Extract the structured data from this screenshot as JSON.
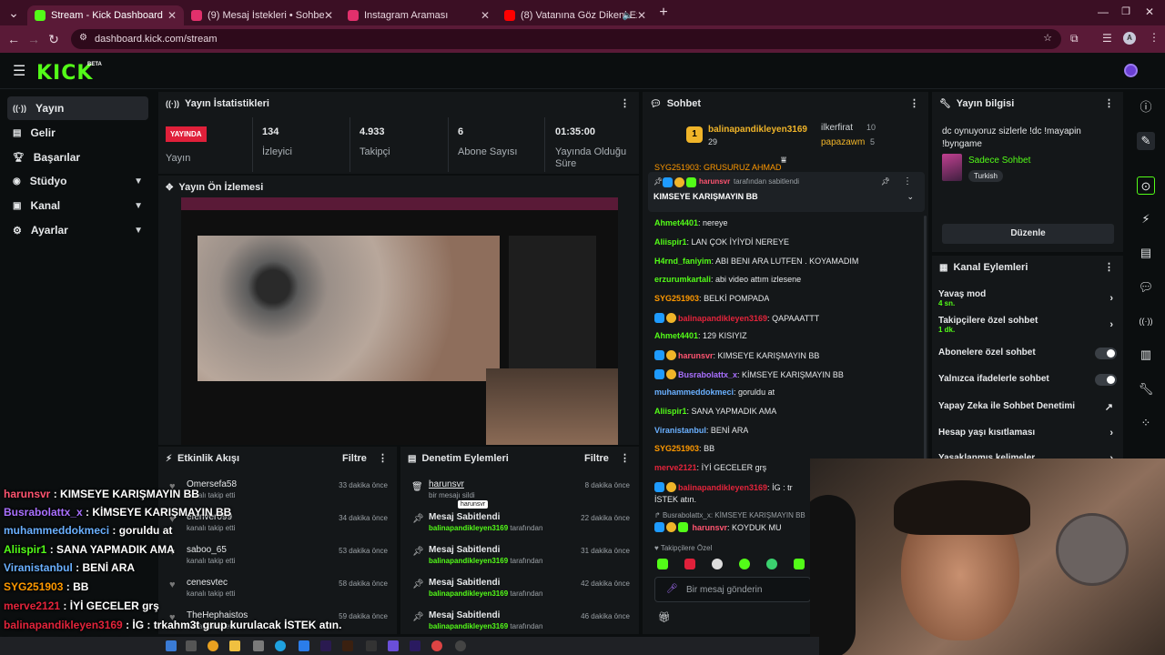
{
  "browser": {
    "tabs": [
      {
        "label": "Stream - Kick Dashboard",
        "color": "#53fc18",
        "active": true
      },
      {
        "label": "(9) Mesaj İstekleri • Sohbetler",
        "color": "#e1306c",
        "active": false
      },
      {
        "label": "Instagram Araması",
        "color": "#e1306c",
        "active": false
      },
      {
        "label": "(8) Vatanına Göz Dikeni Ez",
        "color": "#ff0000",
        "active": false
      }
    ],
    "url": "dashboard.kick.com/stream"
  },
  "header": {
    "logo": "KICK",
    "beta": "BETA"
  },
  "sidebar": {
    "items": [
      {
        "label": "Yayın",
        "icon": "radio-icon",
        "active": true
      },
      {
        "label": "Gelir",
        "icon": "wallet-icon"
      },
      {
        "label": "Başarılar",
        "icon": "trophy-icon"
      },
      {
        "label": "Stüdyo",
        "icon": "studio-icon",
        "expandable": true
      },
      {
        "label": "Kanal",
        "icon": "channel-icon",
        "expandable": true
      },
      {
        "label": "Ayarlar",
        "icon": "gear-icon",
        "expandable": true
      }
    ]
  },
  "stats": {
    "title": "Yayın İstatistikleri",
    "live_badge": "YAYINDA",
    "live_label": "Yayın",
    "viewers": "134",
    "viewers_label": "İzleyici",
    "followers": "4.933",
    "followers_label": "Takipçi",
    "subs": "6",
    "subs_label": "Abone Sayısı",
    "duration": "01:35:00",
    "duration_label": "Yayında Olduğu Süre"
  },
  "preview": {
    "title": "Yayın Ön İzlemesi"
  },
  "activity": {
    "title": "Etkinlik Akışı",
    "filter": "Filtre",
    "rows": [
      {
        "name": "Omersefa58",
        "sub": "kanalı takip etti",
        "time": "33 dakika önce"
      },
      {
        "name": "eferiver099",
        "sub": "kanalı takip etti",
        "time": "34 dakika önce"
      },
      {
        "name": "saboo_65",
        "sub": "kanalı takip etti",
        "time": "53 dakika önce"
      },
      {
        "name": "cenesvtec",
        "sub": "kanalı takip etti",
        "time": "58 dakika önce"
      },
      {
        "name": "TheHephaistos",
        "sub": "kanalı takip etti",
        "time": "59 dakika önce"
      }
    ]
  },
  "moderation": {
    "title": "Denetim Eylemleri",
    "filter": "Filtre",
    "rows": [
      {
        "title": "harunsvr",
        "sub_pre": "bir mesajı sildi",
        "sub_user": "",
        "sub_post": "",
        "time": "8 dakika önce",
        "tooltip": "harunsvr"
      },
      {
        "title": "Mesaj Sabitlendi",
        "sub_pre": "",
        "sub_user": "balinapandikleyen3169",
        "sub_post": "tarafından",
        "time": "22 dakika önce"
      },
      {
        "title": "Mesaj Sabitlendi",
        "sub_pre": "",
        "sub_user": "balinapandikleyen3169",
        "sub_post": "tarafından",
        "time": "31 dakika önce"
      },
      {
        "title": "Mesaj Sabitlendi",
        "sub_pre": "",
        "sub_user": "balinapandikleyen3169",
        "sub_post": "tarafından",
        "time": "42 dakika önce"
      },
      {
        "title": "Mesaj Sabitlendi",
        "sub_pre": "",
        "sub_user": "balinapandikleyen3169",
        "sub_post": "tarafından",
        "time": "46 dakika önce"
      }
    ]
  },
  "chat": {
    "title": "Sohbet",
    "top_gifter": {
      "name": "balinapandikleyen3169",
      "count": "29",
      "rank": "1"
    },
    "gifters": [
      {
        "name": "ilkerfirat",
        "count": "10"
      },
      {
        "name": "papazawm",
        "count": "5"
      }
    ],
    "partial_line": "SYG251903: GRUSURUZ AHMAD",
    "pinned": {
      "user": "harunsvr",
      "suffix": "tarafından sabitlendi",
      "message": "KIMSEYE KARIŞMAYIN BB"
    },
    "messages": [
      {
        "user": "Ahmet4401",
        "color": "#53fc18",
        "text": "nereye",
        "badges": false
      },
      {
        "user": "Aliispir1",
        "color": "#53fc18",
        "text": "LAN ÇOK İYİYDİ NEREYE",
        "badges": false
      },
      {
        "user": "H4rnd_faniyim",
        "color": "#53fc18",
        "text": "ABI BENI ARA LUTFEN . KOYAMADIM",
        "badges": false
      },
      {
        "user": "erzurumkartali",
        "color": "#53fc18",
        "text": "abi video attım izlesene",
        "badges": false
      },
      {
        "user": "SYG251903",
        "color": "#ff9900",
        "text": "BELKİ POMPADA",
        "badges": false
      },
      {
        "user": "balinapandikleyen3169",
        "color": "#e3243b",
        "text": "QAPAAATTT",
        "badges": true
      },
      {
        "user": "Ahmet4401",
        "color": "#53fc18",
        "text": "129 KISIYIZ",
        "badges": false
      },
      {
        "user": "harunsvr",
        "color": "#ff5470",
        "text": "KIMSEYE KARIŞMAYIN BB",
        "badges": true
      },
      {
        "user": "Busrabolattx_x",
        "color": "#a970ff",
        "text": "KİMSEYE KARIŞMAYIN BB",
        "badges": true
      },
      {
        "user": "muhammeddokmeci",
        "color": "#6ab0ff",
        "text": "goruldu at",
        "badges": false
      },
      {
        "user": "Aliispir1",
        "color": "#53fc18",
        "text": "SANA YAPMADIK AMA",
        "badges": false
      },
      {
        "user": "Viranistanbul",
        "color": "#6ab0ff",
        "text": "BENİ ARA",
        "badges": false
      },
      {
        "user": "SYG251903",
        "color": "#ff9900",
        "text": "BB",
        "badges": false
      },
      {
        "user": "merve2121",
        "color": "#e3243b",
        "text": "İYİ GECELER grş",
        "badges": false
      },
      {
        "user": "balinapandikleyen3169",
        "color": "#e3243b",
        "text": "İG : tr",
        "badges": true
      },
      {
        "user": "",
        "color": "#e6e8ea",
        "text": "İSTEK atın.",
        "badges": false
      }
    ],
    "reply_preview": "Busrabolattx_x: KİMSEYE KARIŞMAYIN BB",
    "reply_user": "harunsvr",
    "reply_text": "KOYDUK MU",
    "followers_only": "Takipçilere Özel",
    "input_placeholder": "Bir mesaj gönderin"
  },
  "stream_info": {
    "title": "Yayın bilgisi",
    "text": "dc oynuyoruz sizlerle !dc !mayapin !byngame",
    "category": "Sadece Sohbet",
    "tag": "Turkish",
    "edit": "Düzenle"
  },
  "channel_actions": {
    "title": "Kanal Eylemleri",
    "items": [
      {
        "label": "Yavaş mod",
        "sub": "4 sn.",
        "type": "chevron"
      },
      {
        "label": "Takipçilere özel sohbet",
        "sub": "1 dk.",
        "type": "chevron"
      },
      {
        "label": "Abonelere özel sohbet",
        "sub": "",
        "type": "toggle"
      },
      {
        "label": "Yalnızca ifadelerle sohbet",
        "sub": "",
        "type": "toggle"
      },
      {
        "label": "Yapay Zeka ile Sohbet Denetimi",
        "sub": "",
        "type": "external"
      },
      {
        "label": "Hesap yaşı kısıtlaması",
        "sub": "",
        "type": "chevron"
      },
      {
        "label": "Yasaklanmış kelimeler",
        "sub": "",
        "type": "chevron"
      }
    ]
  },
  "overlay_chat": [
    {
      "user": "harunsvr",
      "text": "KIMSEYE KARIŞMAYIN BB",
      "color": "#ff5470"
    },
    {
      "user": "Busrabolattx_x",
      "text": "KİMSEYE KARIŞMAYIN BB",
      "color": "#a970ff"
    },
    {
      "user": "muhammeddokmeci",
      "text": "goruldu at",
      "color": "#6ab0ff"
    },
    {
      "user": "Aliispir1",
      "text": "SANA YAPMADIK AMA",
      "color": "#53fc18"
    },
    {
      "user": "Viranistanbul",
      "text": "BENİ ARA",
      "color": "#6ab0ff"
    },
    {
      "user": "SYG251903",
      "text": "BB",
      "color": "#ff9900"
    },
    {
      "user": "merve2121",
      "text": "İYİ GECELER grş",
      "color": "#e3243b"
    },
    {
      "user": "balinapandikleyen3169",
      "text": "İG : trkahm3t grup kurulacak İSTEK atın.",
      "color": "#e3243b"
    },
    {
      "user": "harunsvr",
      "text": "KOYDUK MU",
      "color": "#ff5470"
    }
  ],
  "colors": {
    "brand": "#53fc18",
    "live": "#e0203a",
    "panel": "#141719",
    "bg": "#0b0e0f"
  }
}
